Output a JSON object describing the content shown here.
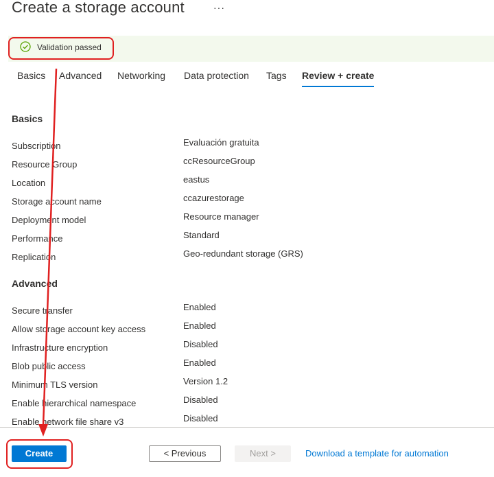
{
  "header": {
    "title": "Create a storage account",
    "more": "···"
  },
  "banner": {
    "message": "Validation passed"
  },
  "tabs": [
    {
      "label": "Basics"
    },
    {
      "label": "Advanced"
    },
    {
      "label": "Networking"
    },
    {
      "label": "Data protection"
    },
    {
      "label": "Tags"
    },
    {
      "label": "Review + create"
    }
  ],
  "basics": {
    "heading": "Basics",
    "rows": [
      {
        "label": "Subscription",
        "value": "Evaluación gratuita"
      },
      {
        "label": "Resource Group",
        "value": "ccResourceGroup"
      },
      {
        "label": "Location",
        "value": "eastus"
      },
      {
        "label": "Storage account name",
        "value": "ccazurestorage"
      },
      {
        "label": "Deployment model",
        "value": "Resource manager"
      },
      {
        "label": "Performance",
        "value": "Standard"
      },
      {
        "label": "Replication",
        "value": "Geo-redundant storage (GRS)"
      }
    ]
  },
  "advanced": {
    "heading": "Advanced",
    "rows": [
      {
        "label": "Secure transfer",
        "value": "Enabled"
      },
      {
        "label": "Allow storage account key access",
        "value": "Enabled"
      },
      {
        "label": "Infrastructure encryption",
        "value": "Disabled"
      },
      {
        "label": "Blob public access",
        "value": "Enabled"
      },
      {
        "label": "Minimum TLS version",
        "value": "Version 1.2"
      },
      {
        "label": "Enable hierarchical namespace",
        "value": "Disabled"
      },
      {
        "label": "Enable network file share v3",
        "value": "Disabled"
      }
    ]
  },
  "footer": {
    "create": "Create",
    "previous": "< Previous",
    "next": "Next >",
    "template_link": "Download a template for automation"
  },
  "colors": {
    "accent": "#0078d4",
    "annotation": "#e02020",
    "success": "#57a300"
  }
}
